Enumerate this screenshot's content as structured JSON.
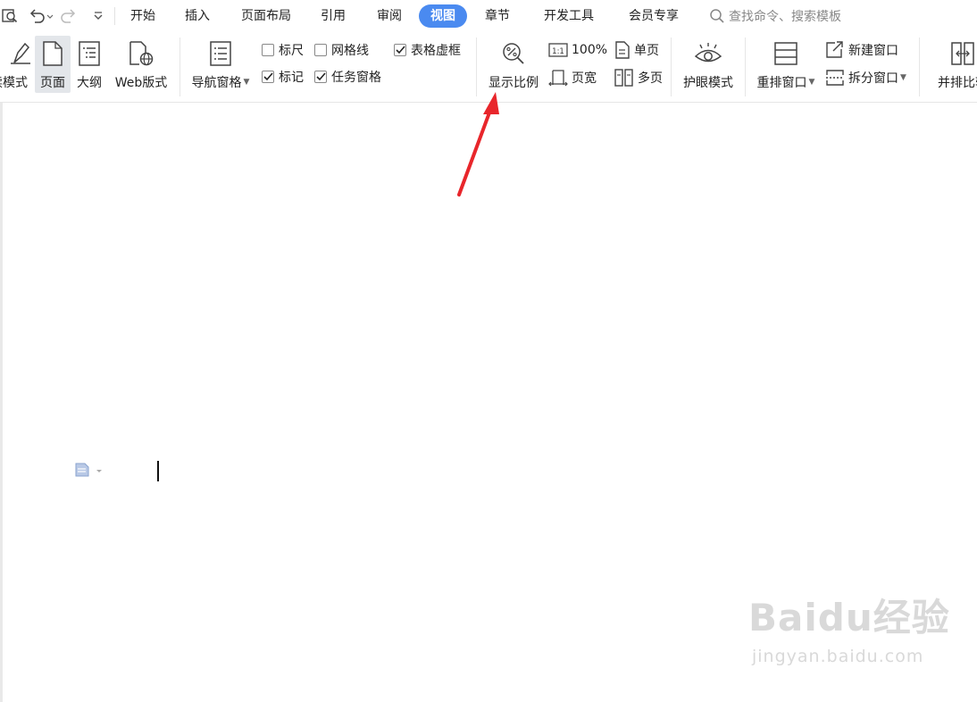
{
  "menu": {
    "tabs": [
      "开始",
      "插入",
      "页面布局",
      "引用",
      "审阅",
      "视图",
      "章节",
      "开发工具",
      "会员专享"
    ],
    "active_tab": "视图",
    "search_placeholder": "查找命令、搜索模板"
  },
  "ribbon": {
    "views": {
      "read_mode": "阅读模式",
      "page": "页面",
      "outline": "大纲",
      "web": "Web版式"
    },
    "nav_pane": "导航窗格",
    "checks": {
      "ruler": {
        "label": "标尺",
        "checked": false
      },
      "gridlines": {
        "label": "网格线",
        "checked": false
      },
      "table_gridlines": {
        "label": "表格虚框",
        "checked": true
      },
      "marks": {
        "label": "标记",
        "checked": true
      },
      "task_pane": {
        "label": "任务窗格",
        "checked": true
      }
    },
    "zoom": {
      "display_ratio": "显示比例",
      "hundred": "100%",
      "page_width": "页宽",
      "one_page": "单页",
      "multi_page": "多页"
    },
    "eye_mode": "护眼模式",
    "window": {
      "arrange": "重排窗口",
      "new_window": "新建窗口",
      "split": "拆分窗口",
      "side_by_side": "并排比较"
    }
  },
  "watermark": {
    "brand": "Baidu经验",
    "url": "jingyan.baidu.com"
  },
  "colors": {
    "accent": "#4a8af0",
    "arrow": "#e8262b"
  }
}
